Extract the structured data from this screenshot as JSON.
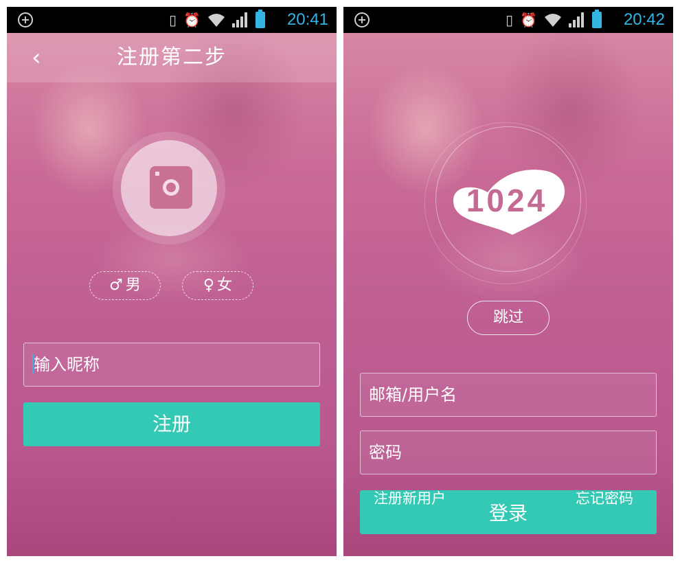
{
  "status_left": {
    "time": "20:41"
  },
  "status_right": {
    "time": "20:42"
  },
  "register": {
    "title": "注册第二步",
    "back_symbol": "‹",
    "gender_male_symbol": "♂",
    "gender_male_label": "男",
    "gender_female_symbol": "♀",
    "gender_female_label": "女",
    "nickname_placeholder": "输入昵称",
    "submit_label": "注册"
  },
  "login": {
    "logo_text": "1024",
    "skip_label": "跳过",
    "username_placeholder": "邮箱/用户名",
    "password_placeholder": "密码",
    "login_label": "登录",
    "register_link": "注册新用户",
    "forgot_link": "忘记密码"
  },
  "colors": {
    "accent": "#33c9b4",
    "status_blue": "#33b5e5",
    "background_pink": "#c96a96"
  },
  "icons": [
    "plus-circle-icon",
    "vibrate-icon",
    "alarm-icon",
    "wifi-icon",
    "signal-icon",
    "battery-icon",
    "camera-icon",
    "back-icon",
    "male-icon",
    "female-icon"
  ]
}
